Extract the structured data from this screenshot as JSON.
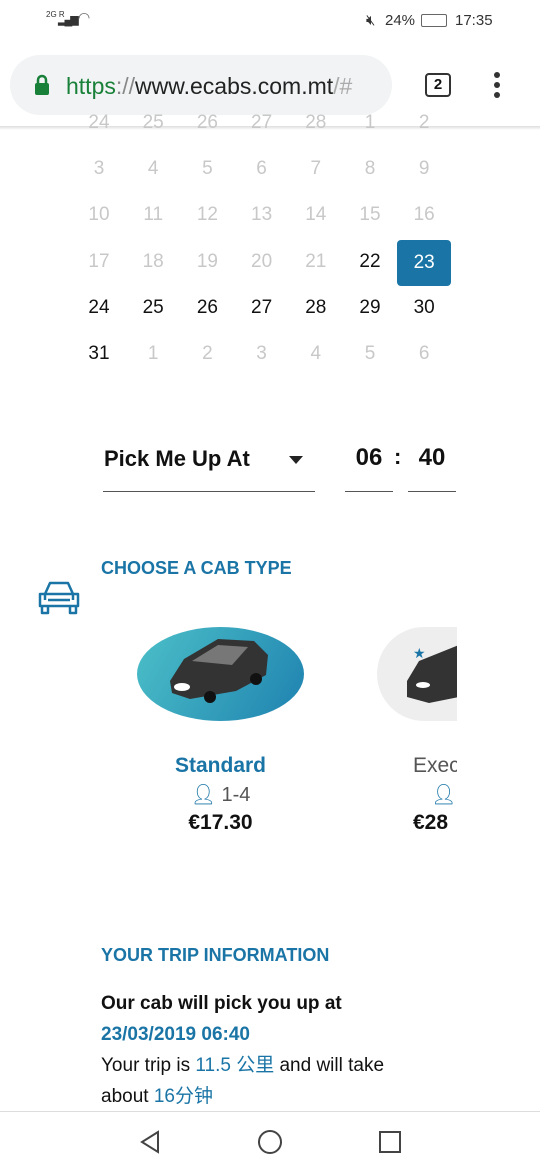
{
  "status_bar": {
    "network": "2G R",
    "mute_icon": "mute-icon",
    "battery": "24%",
    "time": "17:35"
  },
  "browser": {
    "url_scheme": "https",
    "url_sep": "://",
    "url_host": "www.ecabs.com.mt",
    "url_rest": "/#",
    "tab_count": "2"
  },
  "calendar": {
    "rows": [
      [
        {
          "d": "24",
          "dim": true
        },
        {
          "d": "25",
          "dim": true
        },
        {
          "d": "26",
          "dim": true
        },
        {
          "d": "27",
          "dim": true
        },
        {
          "d": "28",
          "dim": true
        },
        {
          "d": "1",
          "dim": true
        },
        {
          "d": "2",
          "dim": true
        }
      ],
      [
        {
          "d": "3",
          "dim": true
        },
        {
          "d": "4",
          "dim": true
        },
        {
          "d": "5",
          "dim": true
        },
        {
          "d": "6",
          "dim": true
        },
        {
          "d": "7",
          "dim": true
        },
        {
          "d": "8",
          "dim": true
        },
        {
          "d": "9",
          "dim": true
        }
      ],
      [
        {
          "d": "10",
          "dim": true
        },
        {
          "d": "11",
          "dim": true
        },
        {
          "d": "12",
          "dim": true
        },
        {
          "d": "13",
          "dim": true
        },
        {
          "d": "14",
          "dim": true
        },
        {
          "d": "15",
          "dim": true
        },
        {
          "d": "16",
          "dim": true
        }
      ],
      [
        {
          "d": "17",
          "dim": true
        },
        {
          "d": "18",
          "dim": true
        },
        {
          "d": "19",
          "dim": true
        },
        {
          "d": "20",
          "dim": true
        },
        {
          "d": "21",
          "dim": true
        },
        {
          "d": "22"
        },
        {
          "d": "23",
          "selected": true
        }
      ],
      [
        {
          "d": "24"
        },
        {
          "d": "25"
        },
        {
          "d": "26"
        },
        {
          "d": "27"
        },
        {
          "d": "28"
        },
        {
          "d": "29"
        },
        {
          "d": "30"
        }
      ],
      [
        {
          "d": "31"
        },
        {
          "d": "1",
          "dim": true
        },
        {
          "d": "2",
          "dim": true
        },
        {
          "d": "3",
          "dim": true
        },
        {
          "d": "4",
          "dim": true
        },
        {
          "d": "5",
          "dim": true
        },
        {
          "d": "6",
          "dim": true
        }
      ]
    ]
  },
  "pickup": {
    "mode": "Pick Me Up At",
    "hour": "06",
    "sep": ":",
    "minute": "40"
  },
  "cab": {
    "heading": "CHOOSE A CAB TYPE",
    "options": [
      {
        "name": "Standard",
        "passengers": "1-4",
        "price": "€17.30"
      },
      {
        "name": "Exec",
        "price": "€28"
      }
    ]
  },
  "trip": {
    "heading": "YOUR TRIP INFORMATION",
    "line1": "Our cab will pick you up at",
    "datetime": "23/03/2019 06:40",
    "t1": "Your trip is ",
    "distance": "11.5 公里",
    "t2": " and will take",
    "t3": "about ",
    "duration": "16分钟"
  },
  "colors": {
    "accent": "#1a75a6",
    "secure": "#188038"
  }
}
